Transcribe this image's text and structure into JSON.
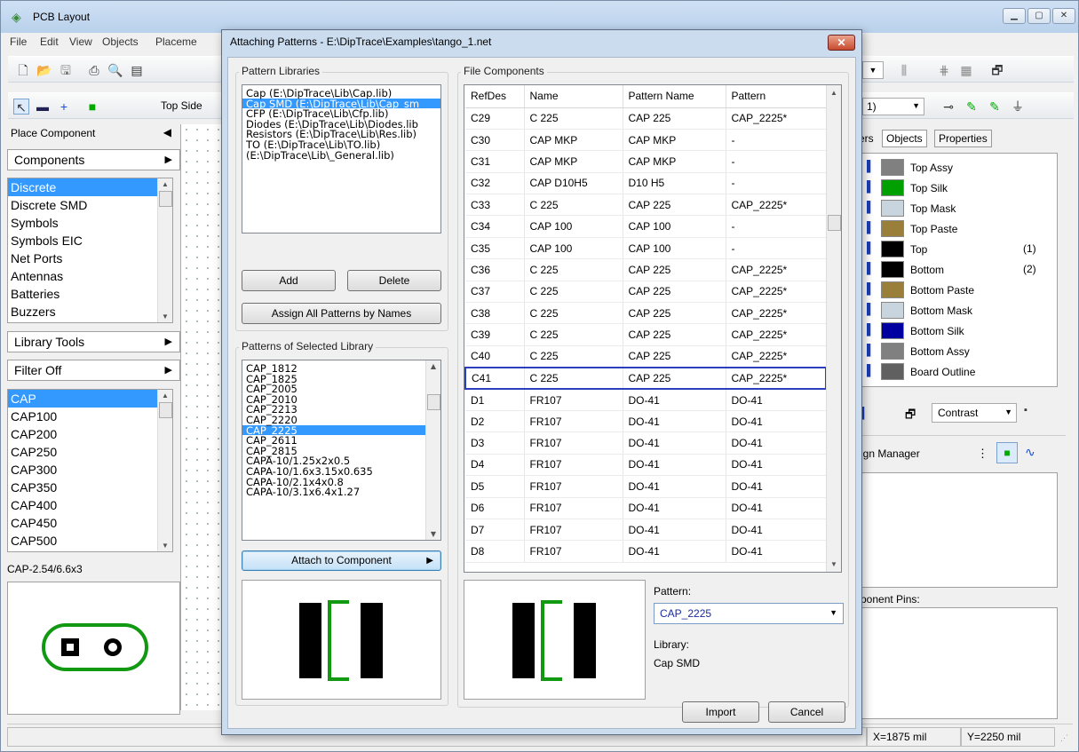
{
  "main": {
    "title": "PCB Layout",
    "menu": [
      "File",
      "Edit",
      "View",
      "Objects",
      "Placeme"
    ],
    "toolbar_side": "Top Side",
    "toolbar_right_value": "1)"
  },
  "left": {
    "place_component": "Place Component",
    "components_label": "Components",
    "categories": [
      "Discrete",
      "Discrete SMD",
      "Symbols",
      "Symbols EIC",
      "Net Ports",
      "Antennas",
      "Batteries",
      "Buzzers"
    ],
    "library_tools": "Library Tools",
    "filter": "Filter Off",
    "parts": [
      "CAP",
      "CAP100",
      "CAP200",
      "CAP250",
      "CAP300",
      "CAP350",
      "CAP400",
      "CAP450",
      "CAP500"
    ],
    "selected_pattern": "CAP-2.54/6.6x3"
  },
  "right": {
    "tabs": [
      "ers",
      "Objects",
      "Properties"
    ],
    "layers": [
      {
        "name": "Top Assy",
        "color": "#808080",
        "extra": ""
      },
      {
        "name": "Top Silk",
        "color": "#00a000",
        "extra": ""
      },
      {
        "name": "Top Mask",
        "color": "#c8d4de",
        "extra": ""
      },
      {
        "name": "Top Paste",
        "color": "#9a7f3a",
        "extra": ""
      },
      {
        "name": "Top",
        "color": "#000000",
        "extra": "(1)"
      },
      {
        "name": "Bottom",
        "color": "#000000",
        "extra": "(2)"
      },
      {
        "name": "Bottom Paste",
        "color": "#9a7f3a",
        "extra": ""
      },
      {
        "name": "Bottom Mask",
        "color": "#c8d4de",
        "extra": ""
      },
      {
        "name": "Bottom Silk",
        "color": "#0000a0",
        "extra": ""
      },
      {
        "name": "Bottom Assy",
        "color": "#808080",
        "extra": ""
      },
      {
        "name": "Board Outline",
        "color": "#606060",
        "extra": ""
      }
    ],
    "contrast": "Contrast",
    "manager": "ign Manager",
    "component_pins": "ponent Pins:"
  },
  "status": {
    "x": "X=1875 mil",
    "y": "Y=2250 mil"
  },
  "dialog": {
    "title": "Attaching Patterns - E:\\DipTrace\\Examples\\tango_1.net",
    "pattern_libraries_title": "Pattern Libraries",
    "libraries": [
      "Cap   (E:\\DipTrace\\Lib\\Cap.lib)",
      "Cap SMD   (E:\\DipTrace\\Lib\\Cap_sm",
      "CFP   (E:\\DipTrace\\Lib\\Cfp.lib)",
      "Diodes   (E:\\DipTrace\\Lib\\Diodes.lib",
      "Resistors   (E:\\DipTrace\\Lib\\Res.lib)",
      "TO   (E:\\DipTrace\\Lib\\TO.lib)",
      "    (E:\\DipTrace\\Lib\\_General.lib)"
    ],
    "add": "Add",
    "delete": "Delete",
    "assign_all": "Assign All Patterns by Names",
    "patterns_title": "Patterns of Selected Library",
    "patterns": [
      "CAP_1812",
      "CAP_1825",
      "CAP_2005",
      "CAP_2010",
      "CAP_2213",
      "CAP_2220",
      "CAP_2225",
      "CAP_2611",
      "CAP_2815",
      "CAPA-10/1.25x2x0.5",
      "CAPA-10/1.6x3.15x0.635",
      "CAPA-10/2.1x4x0.8",
      "CAPA-10/3.1x6.4x1.27"
    ],
    "attach": "Attach to Component",
    "file_components_title": "File Components",
    "columns": [
      "RefDes",
      "Name",
      "Pattern Name",
      "Pattern"
    ],
    "rows": [
      [
        "C29",
        "C 225",
        "CAP 225",
        "CAP_2225*"
      ],
      [
        "C30",
        "CAP MKP",
        "CAP MKP",
        "-"
      ],
      [
        "C31",
        "CAP MKP",
        "CAP MKP",
        "-"
      ],
      [
        "C32",
        "CAP D10H5",
        "D10 H5",
        "-"
      ],
      [
        "C33",
        "C 225",
        "CAP 225",
        "CAP_2225*"
      ],
      [
        "C34",
        "CAP 100",
        "CAP 100",
        "-"
      ],
      [
        "C35",
        "CAP 100",
        "CAP 100",
        "-"
      ],
      [
        "C36",
        "C 225",
        "CAP 225",
        "CAP_2225*"
      ],
      [
        "C37",
        "C 225",
        "CAP 225",
        "CAP_2225*"
      ],
      [
        "C38",
        "C 225",
        "CAP 225",
        "CAP_2225*"
      ],
      [
        "C39",
        "C 225",
        "CAP 225",
        "CAP_2225*"
      ],
      [
        "C40",
        "C 225",
        "CAP 225",
        "CAP_2225*"
      ],
      [
        "C41",
        "C 225",
        "CAP 225",
        "CAP_2225*"
      ],
      [
        "D1",
        "FR107",
        "DO-41",
        "DO-41"
      ],
      [
        "D2",
        "FR107",
        "DO-41",
        "DO-41"
      ],
      [
        "D3",
        "FR107",
        "DO-41",
        "DO-41"
      ],
      [
        "D4",
        "FR107",
        "DO-41",
        "DO-41"
      ],
      [
        "D5",
        "FR107",
        "DO-41",
        "DO-41"
      ],
      [
        "D6",
        "FR107",
        "DO-41",
        "DO-41"
      ],
      [
        "D7",
        "FR107",
        "DO-41",
        "DO-41"
      ],
      [
        "D8",
        "FR107",
        "DO-41",
        "DO-41"
      ]
    ],
    "highlighted_row": "C41",
    "pattern_label": "Pattern:",
    "pattern_value": "CAP_2225",
    "library_label": "Library:",
    "library_value": "Cap SMD",
    "import": "Import",
    "cancel": "Cancel"
  }
}
